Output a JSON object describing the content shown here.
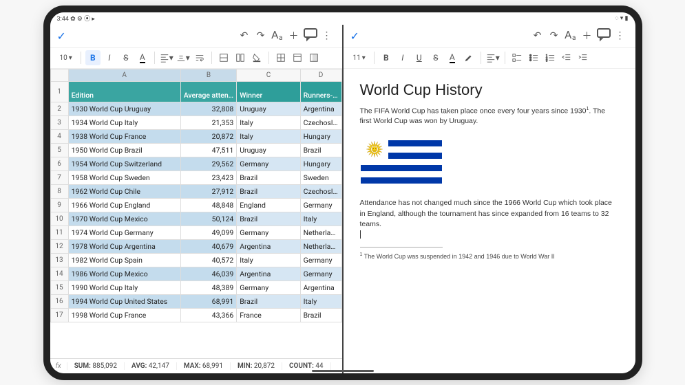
{
  "statusbar": {
    "time": "3:44",
    "left_icons": "✿ ⚙ ⦿ ▸",
    "right_icons": "◌ ▾ ▮"
  },
  "sheets": {
    "font_size": "10",
    "col_letters": [
      "A",
      "B",
      "C",
      "D"
    ],
    "headers": {
      "a": "Edition",
      "b": "Average attendance",
      "c": "Winner",
      "d": "Runners-up"
    },
    "rows": [
      {
        "n": 1,
        "a": "1930 World Cup Uruguay",
        "b": "32,808",
        "c": "Uruguay",
        "d": "Argentina"
      },
      {
        "n": 2,
        "a": "1934 World Cup Italy",
        "b": "21,353",
        "c": "Italy",
        "d": "Czechoslovakia"
      },
      {
        "n": 3,
        "a": "1938 World Cup France",
        "b": "20,872",
        "c": "Italy",
        "d": "Hungary"
      },
      {
        "n": 4,
        "a": "1950 World Cup Brazil",
        "b": "47,511",
        "c": "Uruguay",
        "d": "Brazil"
      },
      {
        "n": 5,
        "a": "1954 World Cup Switzerland",
        "b": "29,562",
        "c": "Germany",
        "d": "Hungary"
      },
      {
        "n": 6,
        "a": "1958 World Cup Sweden",
        "b": "23,423",
        "c": "Brazil",
        "d": "Sweden"
      },
      {
        "n": 7,
        "a": "1962 World Cup Chile",
        "b": "27,912",
        "c": "Brazil",
        "d": "Czechoslovakia"
      },
      {
        "n": 8,
        "a": "1966 World Cup England",
        "b": "48,848",
        "c": "England",
        "d": "Germany"
      },
      {
        "n": 9,
        "a": "1970 World Cup Mexico",
        "b": "50,124",
        "c": "Brazil",
        "d": "Italy"
      },
      {
        "n": 10,
        "a": "1974 World Cup Germany",
        "b": "49,099",
        "c": "Germany",
        "d": "Netherlands"
      },
      {
        "n": 11,
        "a": "1978 World Cup Argentina",
        "b": "40,679",
        "c": "Argentina",
        "d": "Netherlands"
      },
      {
        "n": 12,
        "a": "1982 World Cup Spain",
        "b": "40,572",
        "c": "Italy",
        "d": "Germany"
      },
      {
        "n": 13,
        "a": "1986 World Cup Mexico",
        "b": "46,039",
        "c": "Argentina",
        "d": "Germany"
      },
      {
        "n": 14,
        "a": "1990 World Cup Italy",
        "b": "48,389",
        "c": "Germany",
        "d": "Argentina"
      },
      {
        "n": 15,
        "a": "1994 World Cup United States",
        "b": "68,991",
        "c": "Brazil",
        "d": "Italy"
      },
      {
        "n": 16,
        "a": "1998 World Cup France",
        "b": "43,366",
        "c": "France",
        "d": "Brazil"
      }
    ],
    "stats": {
      "fx": "fx",
      "sum_label": "SUM:",
      "sum": "885,092",
      "avg_label": "AVG:",
      "avg": "42,147",
      "max_label": "MAX:",
      "max": "68,991",
      "min_label": "MIN:",
      "min": "20,872",
      "count_label": "COUNT:",
      "count": "44"
    }
  },
  "docs": {
    "font_size": "11",
    "title": "World Cup History",
    "p1a": "The FIFA World Cup has taken place once every four years since 1930",
    "p1sup": "1",
    "p1b": ". The first World Cup was won by Uruguay.",
    "p2": "Attendance has not changed much since the 1966 World Cup which took place in England, although the tournament has since expanded from 16 teams to 32 teams.",
    "fn_num": "1",
    "fn_text": " The World Cup was suspended in 1942 and 1946 due to World War II"
  }
}
